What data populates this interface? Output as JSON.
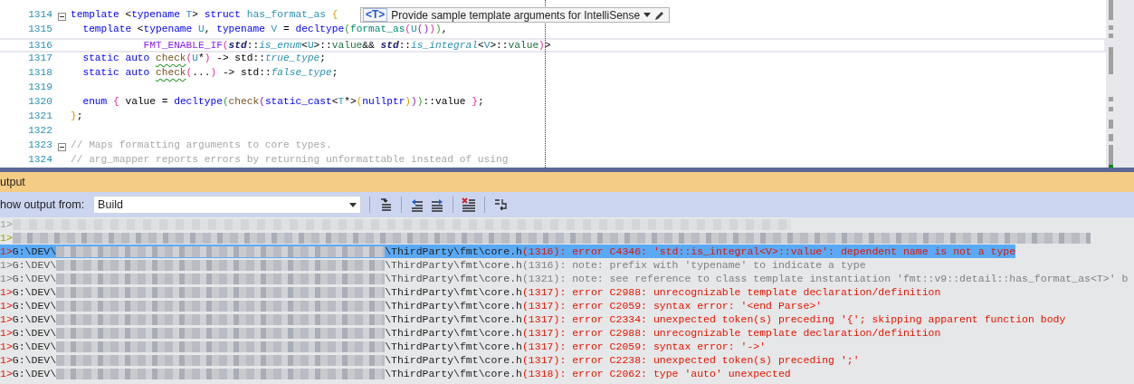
{
  "editor": {
    "code_lines": [
      {
        "number": "1314",
        "fold": true,
        "current": false,
        "tokens": [
          {
            "text": "template",
            "kind": "kw"
          },
          {
            "text": " <",
            "kind": "op"
          },
          {
            "text": "typename",
            "kind": "kw"
          },
          {
            "text": " T",
            "kind": "type"
          },
          {
            "text": "> ",
            "kind": "op"
          },
          {
            "text": "struct",
            "kind": "kw"
          },
          {
            "text": " has_format_as",
            "kind": "type"
          },
          {
            "text": " {",
            "kind": "b1"
          }
        ]
      },
      {
        "number": "1315",
        "fold": false,
        "current": false,
        "tokens": [
          {
            "text": "  template",
            "kind": "kw"
          },
          {
            "text": " <",
            "kind": "op"
          },
          {
            "text": "typename",
            "kind": "kw"
          },
          {
            "text": " U",
            "kind": "type"
          },
          {
            "text": ", ",
            "kind": "op"
          },
          {
            "text": "typename",
            "kind": "kw"
          },
          {
            "text": " V",
            "kind": "type"
          },
          {
            "text": " = ",
            "kind": "op"
          },
          {
            "text": "decltype",
            "kind": "kw"
          },
          {
            "text": "(",
            "kind": "b4"
          },
          {
            "text": "format_as",
            "kind": "fn2"
          },
          {
            "text": "(",
            "kind": "b2"
          },
          {
            "text": "U",
            "kind": "type"
          },
          {
            "text": "()",
            "kind": "b3"
          },
          {
            "text": ")",
            "kind": "b2"
          },
          {
            "text": ")",
            "kind": "b4"
          },
          {
            "text": ",",
            "kind": "op"
          }
        ]
      },
      {
        "number": "1316",
        "fold": false,
        "current": true,
        "tokens": [
          {
            "text": "            FMT_ENABLE_IF",
            "kind": "macro"
          },
          {
            "text": "(",
            "kind": "b2"
          },
          {
            "text": "std",
            "kind": "ns"
          },
          {
            "text": "::",
            "kind": "op"
          },
          {
            "text": "is_enum",
            "kind": "itype"
          },
          {
            "text": "<",
            "kind": "op"
          },
          {
            "text": "U",
            "kind": "type"
          },
          {
            "text": ">::",
            "kind": "op"
          },
          {
            "text": "value",
            "kind": "member"
          },
          {
            "text": "&& ",
            "kind": "op"
          },
          {
            "text": "std",
            "kind": "ns"
          },
          {
            "text": "::",
            "kind": "op"
          },
          {
            "text": "is_integral",
            "kind": "itype"
          },
          {
            "text": "<",
            "kind": "op"
          },
          {
            "text": "V",
            "kind": "type"
          },
          {
            "text": ">::",
            "kind": "op"
          },
          {
            "text": "value",
            "kind": "member"
          },
          {
            "text": ")",
            "kind": "b2"
          },
          {
            "text": ">",
            "kind": "op"
          }
        ]
      },
      {
        "number": "1317",
        "fold": false,
        "current": false,
        "tokens": [
          {
            "text": "  static",
            "kind": "kw"
          },
          {
            "text": " auto ",
            "kind": "kw"
          },
          {
            "text": "check",
            "kind": "squiggle"
          },
          {
            "text": "(",
            "kind": "b2"
          },
          {
            "text": "U",
            "kind": "type"
          },
          {
            "text": "*",
            "kind": "op"
          },
          {
            "text": ")",
            "kind": "b2"
          },
          {
            "text": " -> std::",
            "kind": "op"
          },
          {
            "text": "true_type",
            "kind": "itype"
          },
          {
            "text": ";",
            "kind": "op"
          }
        ]
      },
      {
        "number": "1318",
        "fold": false,
        "current": false,
        "tokens": [
          {
            "text": "  static",
            "kind": "kw"
          },
          {
            "text": " auto ",
            "kind": "kw"
          },
          {
            "text": "check",
            "kind": "squiggle"
          },
          {
            "text": "(",
            "kind": "b2"
          },
          {
            "text": "...",
            "kind": "op"
          },
          {
            "text": ")",
            "kind": "b2"
          },
          {
            "text": " -> std::",
            "kind": "op"
          },
          {
            "text": "false_type",
            "kind": "itype"
          },
          {
            "text": ";",
            "kind": "op"
          }
        ]
      },
      {
        "number": "1319",
        "fold": false,
        "current": false
      },
      {
        "number": "1320",
        "fold": false,
        "current": false,
        "tokens": [
          {
            "text": "  enum",
            "kind": "kw"
          },
          {
            "text": " {",
            "kind": "b2"
          },
          {
            "text": " value = ",
            "kind": "op"
          },
          {
            "text": "decltype",
            "kind": "kw"
          },
          {
            "text": "(",
            "kind": "b4"
          },
          {
            "text": "check",
            "kind": "fn"
          },
          {
            "text": "(",
            "kind": "b3"
          },
          {
            "text": "static_cast",
            "kind": "kw"
          },
          {
            "text": "<",
            "kind": "op"
          },
          {
            "text": "T",
            "kind": "type"
          },
          {
            "text": "*>",
            "kind": "op"
          },
          {
            "text": "(",
            "kind": "b1"
          },
          {
            "text": "nullptr",
            "kind": "kw"
          },
          {
            "text": ")",
            "kind": "b1"
          },
          {
            "text": ")",
            "kind": "b3"
          },
          {
            "text": ")",
            "kind": "b4"
          },
          {
            "text": "::value ",
            "kind": "op"
          },
          {
            "text": "}",
            "kind": "b2"
          },
          {
            "text": ";",
            "kind": "op"
          }
        ]
      },
      {
        "number": "1321",
        "fold": false,
        "current": false,
        "tokens": [
          {
            "text": "}",
            "kind": "b1"
          },
          {
            "text": ";",
            "kind": "op"
          }
        ]
      },
      {
        "number": "1322",
        "fold": false,
        "current": false
      },
      {
        "number": "1323",
        "fold": true,
        "current": false,
        "tokens": [
          {
            "text": "// Maps formatting arguments to core types.",
            "kind": "cmt"
          }
        ]
      },
      {
        "number": "1324",
        "fold": false,
        "current": false,
        "tokens": [
          {
            "text": "// arg_mapper reports errors by returning unformattable instead of using",
            "kind": "cmt"
          }
        ]
      }
    ],
    "template_hint": {
      "badge": "<T>",
      "text": "Provide sample template arguments for IntelliSense"
    }
  },
  "output": {
    "title": "utput",
    "source_label": "how output from:",
    "source_value": "Build",
    "rows": [
      {
        "prefix": "1>",
        "kind": "info",
        "redacted": true,
        "selected": false
      },
      {
        "prefix": "1>",
        "kind": "warning",
        "redacted": true,
        "selected": false
      },
      {
        "prefix": "1>",
        "kind": "error",
        "redacted": false,
        "selected": true,
        "drive": "G:\\DEV\\",
        "file": "\\ThirdParty\\fmt\\core.h",
        "line": "(1316)",
        "message": ": error C4346: 'std::is_integral<V>::value': dependent name is not a type"
      },
      {
        "prefix": "1>",
        "kind": "note",
        "redacted": false,
        "selected": false,
        "drive": "G:\\DEV\\",
        "file": "\\ThirdParty\\fmt\\core.h",
        "line": "(1316)",
        "message": ": note: prefix with 'typename' to indicate a type"
      },
      {
        "prefix": "1>",
        "kind": "note",
        "redacted": false,
        "selected": false,
        "drive": "G:\\DEV\\",
        "file": "\\ThirdParty\\fmt\\core.h",
        "line": "(1321)",
        "message": ": note: see reference to class template instantiation 'fmt::v9::detail::has_format_as<T>' b"
      },
      {
        "prefix": "1>",
        "kind": "error",
        "redacted": false,
        "selected": false,
        "drive": "G:\\DEV\\",
        "file": "\\ThirdParty\\fmt\\core.h",
        "line": "(1317)",
        "message": ": error C2988: unrecognizable template declaration/definition"
      },
      {
        "prefix": "1>",
        "kind": "error",
        "redacted": false,
        "selected": false,
        "drive": "G:\\DEV\\",
        "file": "\\ThirdParty\\fmt\\core.h",
        "line": "(1317)",
        "message": ": error C2059: syntax error: '<end Parse>'"
      },
      {
        "prefix": "1>",
        "kind": "error",
        "redacted": false,
        "selected": false,
        "drive": "G:\\DEV\\",
        "file": "\\ThirdParty\\fmt\\core.h",
        "line": "(1317)",
        "message": ": error C2334: unexpected token(s) preceding '{'; skipping apparent function body"
      },
      {
        "prefix": "1>",
        "kind": "error",
        "redacted": false,
        "selected": false,
        "drive": "G:\\DEV\\",
        "file": "\\ThirdParty\\fmt\\core.h",
        "line": "(1317)",
        "message": ": error C2988: unrecognizable template declaration/definition"
      },
      {
        "prefix": "1>",
        "kind": "error",
        "redacted": false,
        "selected": false,
        "drive": "G:\\DEV\\",
        "file": "\\ThirdParty\\fmt\\core.h",
        "line": "(1317)",
        "message": ": error C2059: syntax error: '->'"
      },
      {
        "prefix": "1>",
        "kind": "error",
        "redacted": false,
        "selected": false,
        "drive": "G:\\DEV\\",
        "file": "\\ThirdParty\\fmt\\core.h",
        "line": "(1317)",
        "message": ": error C2238: unexpected token(s) preceding ';'"
      },
      {
        "prefix": "1>",
        "kind": "error",
        "redacted": false,
        "selected": false,
        "drive": "G:\\DEV\\",
        "file": "\\ThirdParty\\fmt\\core.h",
        "line": "(1318)",
        "message": ": error C2062: type 'auto' unexpected"
      }
    ]
  }
}
